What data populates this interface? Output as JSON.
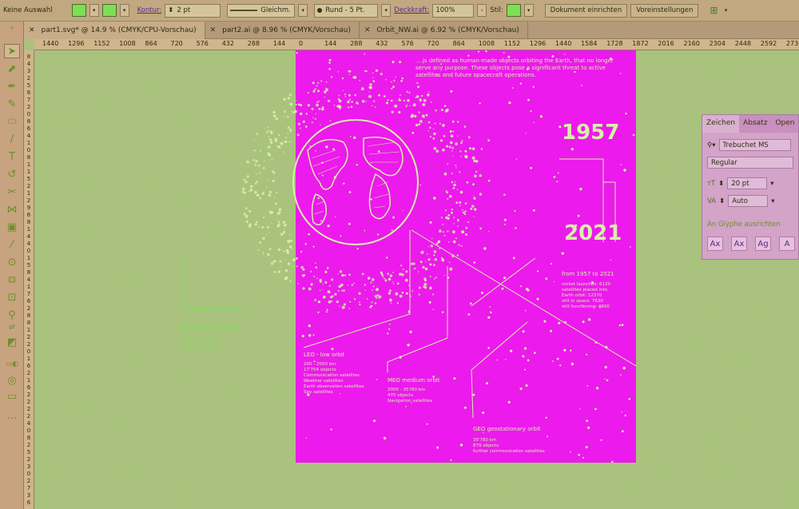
{
  "control_bar": {
    "selection": "Keine Auswahl",
    "kontur_label": "Kontur:",
    "kontur_value": "2 pt",
    "stroke_style": "Gleichm.",
    "brush": "Rund - 5 Pt.",
    "deckkraft_label": "Deckkraft:",
    "deckkraft_value": "100%",
    "stil_label": "Stil:",
    "doc_button": "Dokument einrichten",
    "prefs_button": "Voreinstellungen"
  },
  "tabs": [
    {
      "label": "part1.svg* @ 14.9 % (CMYK/CPU-Vorschau)"
    },
    {
      "label": "part2.ai @ 8.96 % (CMYK/Vorschau)"
    },
    {
      "label": "Orbit_NW.ai @ 6.92 % (CMYK/Vorschau)"
    }
  ],
  "ruler_h": [
    "1440",
    "1296",
    "1152",
    "1008",
    "864",
    "720",
    "576",
    "432",
    "288",
    "144",
    "0",
    "144",
    "288",
    "432",
    "576",
    "720",
    "864",
    "1008",
    "1152",
    "1296",
    "1440",
    "1584",
    "1728",
    "1872",
    "2016",
    "2160",
    "2304",
    "2448",
    "2592",
    "2736"
  ],
  "ruler_v": [
    "8",
    "4",
    "3",
    "2",
    "5",
    "6",
    "7",
    "2",
    "0",
    "8",
    "6",
    "4",
    "1",
    "0",
    "8",
    "1",
    "1",
    "5",
    "2",
    "1",
    "2",
    "9",
    "6",
    "8",
    "1",
    "4",
    "4",
    "0",
    "1",
    "5",
    "8",
    "4",
    "1",
    "7",
    "6",
    "2",
    "8",
    "8",
    "1",
    "2",
    "2",
    "0",
    "1",
    "6",
    "2",
    "1",
    "6",
    "2",
    "2",
    "2",
    "2",
    "4",
    "0",
    "8",
    "2",
    "5",
    "2",
    "3",
    "0",
    "2",
    "7",
    "3",
    "6"
  ],
  "artboard": {
    "intro": "... is defined as human-made objects orbiting the Earth, that no longer serve any purpose. These objects pose a significant threat to active satellites and future spacecraft operations.",
    "year_start": "1957",
    "year_end": "2021",
    "range_heading": "from 1957 to 2021",
    "stats": "rocket launches: 6120\nsatellites  placed into\nEarth orbit: 12370\nstill in space: 7630\nstill functioning: 4800",
    "leo_title": "LEO -  low orbit",
    "leo_details": "200 - 2000 km\n17'754 objects\nCommunication satellites\nWeather satellites\nEarth observation satellites\nSpy satellites",
    "meo_title": "MEO medium orbit",
    "meo_details": "2000 - 35780 km\n475 objects\nNavigation satellites",
    "geo_title": "GEO geostationary orbit",
    "geo_details": "35'780 km\n879 objects\nfurther communication satellites"
  },
  "canvas_text": {
    "zone_title": "high frequency zone",
    "zone_details": "600 - 1'000 km\npreferred path for\nsatellite positioning"
  },
  "char_panel": {
    "tabs": [
      "Zeichen",
      "Absatz",
      "Open"
    ],
    "font": "Trebuchet MS",
    "style": "Regular",
    "size": "20 pt",
    "leading": "Auto",
    "align_label": "An Glyphe ausrichten"
  },
  "colors": {
    "artboard": "#ec1aec",
    "canvas": "#a9c27d",
    "accent_green": "#7ddf55",
    "ui": "#c1a880"
  }
}
